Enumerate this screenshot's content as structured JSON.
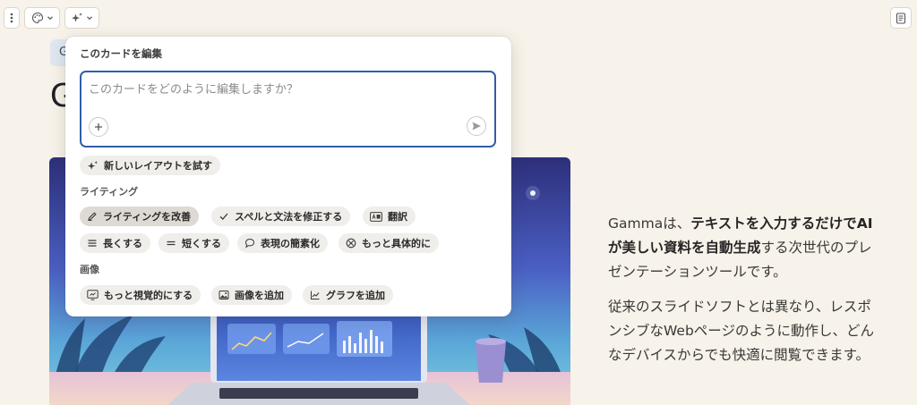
{
  "toolbar": {
    "menu_icon": "more-vertical-icon",
    "theme_icon": "palette-icon",
    "ai_icon": "sparkle-icon",
    "notes_icon": "notes-icon"
  },
  "card": {
    "tag_letter": "G",
    "title_partial": "G"
  },
  "popover": {
    "heading": "このカードを編集",
    "prompt_placeholder": "このカードをどのように編集しますか？",
    "try_layout_label": "新しいレイアウトを試す",
    "writing_section_label": "ライティング",
    "writing_actions": [
      {
        "label": "ライティングを改善",
        "icon": "pen-icon",
        "active": true
      },
      {
        "label": "スペルと文法を修正する",
        "icon": "check-icon"
      },
      {
        "label": "翻訳",
        "icon": "translate-icon"
      },
      {
        "label": "長くする",
        "icon": "lines-icon"
      },
      {
        "label": "短くする",
        "icon": "equals-icon"
      },
      {
        "label": "表現の簡素化",
        "icon": "speech-bubble-icon"
      },
      {
        "label": "もっと具体的に",
        "icon": "target-icon"
      }
    ],
    "image_section_label": "画像",
    "image_actions": [
      {
        "label": "もっと視覚的にする",
        "icon": "presentation-icon"
      },
      {
        "label": "画像を追加",
        "icon": "image-icon"
      },
      {
        "label": "グラフを追加",
        "icon": "line-chart-icon"
      }
    ]
  },
  "side_text": {
    "p1_start": "Gammaは、",
    "p1_bold": "テキストを入力するだけでAIが美しい資料を自動生成",
    "p1_end": "する次世代のプレゼンテーションツールです。",
    "p2": "従来のスライドソフトとは異なり、レスポンシブなWebページのように動作し、どんなデバイスからでも快適に閲覧できます。"
  },
  "colors": {
    "page_bg": "#f7f3ea",
    "focus_border": "#2f5fa8",
    "chip_bg": "#f0eeea"
  }
}
